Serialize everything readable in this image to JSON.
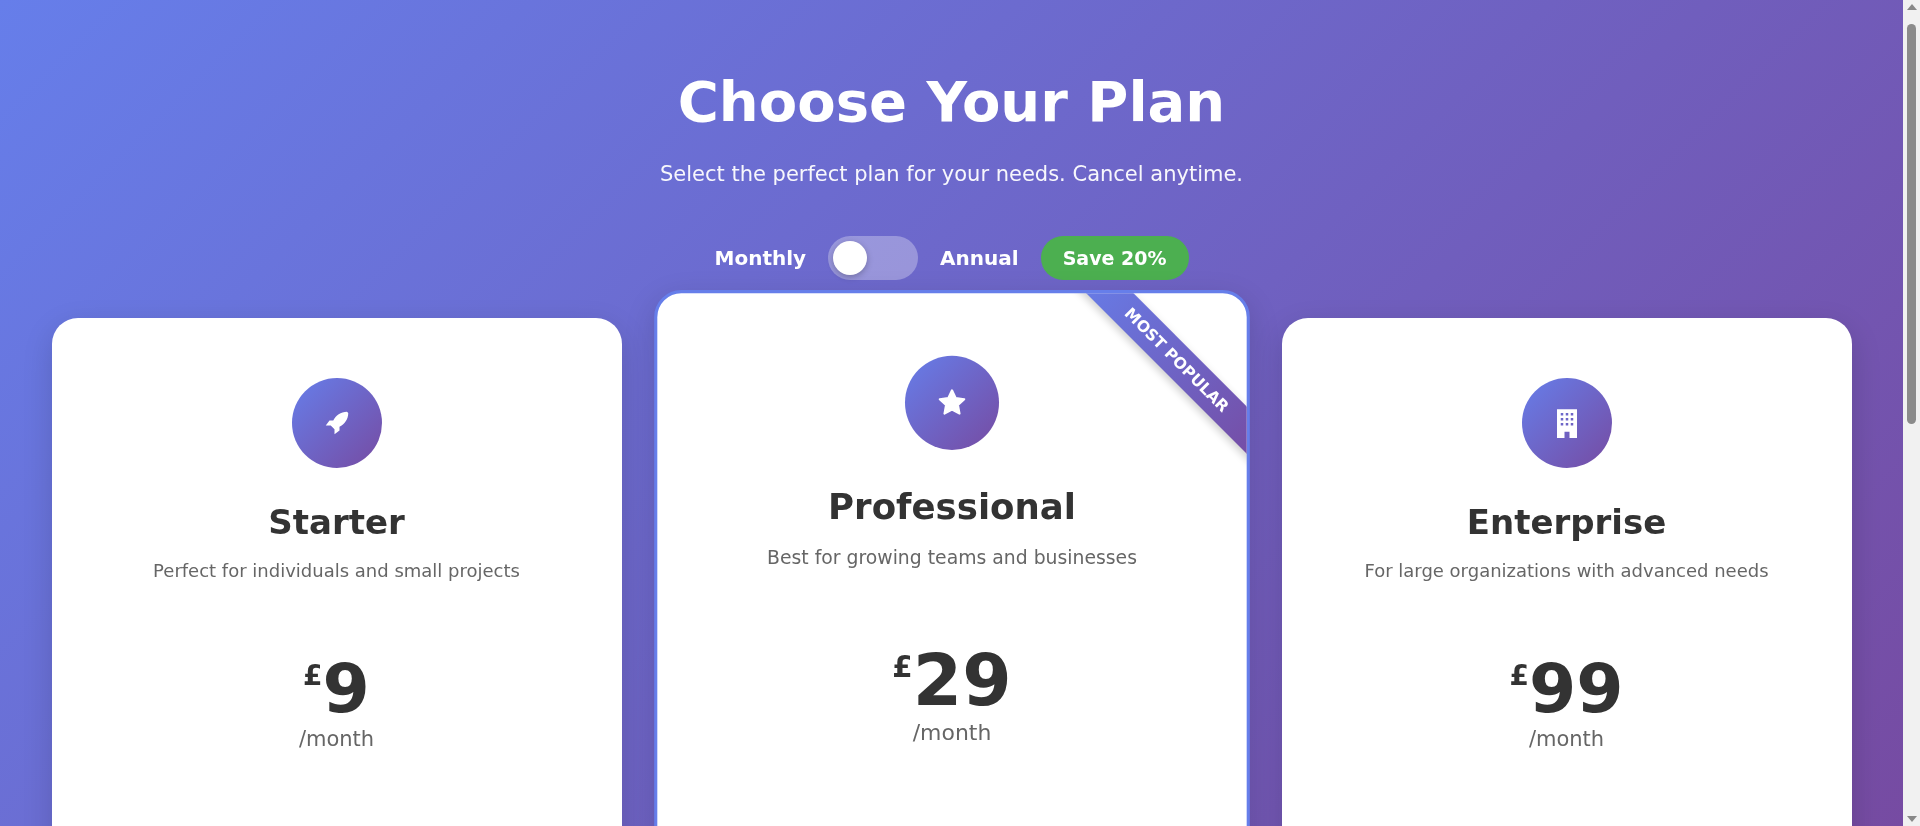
{
  "header": {
    "title": "Choose Your Plan",
    "subtitle": "Select the perfect plan for your needs. Cancel anytime."
  },
  "billing": {
    "left_label": "Monthly",
    "right_label": "Annual",
    "on": false,
    "badge": "Save 20%"
  },
  "plans": [
    {
      "name": "Starter",
      "description": "Perfect for individuals and small projects",
      "currency": "£",
      "price": "9",
      "period": "/month",
      "featured": false
    },
    {
      "name": "Professional",
      "description": "Best for growing teams and businesses",
      "currency": "£",
      "price": "29",
      "period": "/month",
      "featured": true,
      "ribbon": "MOST POPULAR"
    },
    {
      "name": "Enterprise",
      "description": "For large organizations with advanced needs",
      "currency": "£",
      "price": "99",
      "period": "/month",
      "featured": false
    }
  ]
}
